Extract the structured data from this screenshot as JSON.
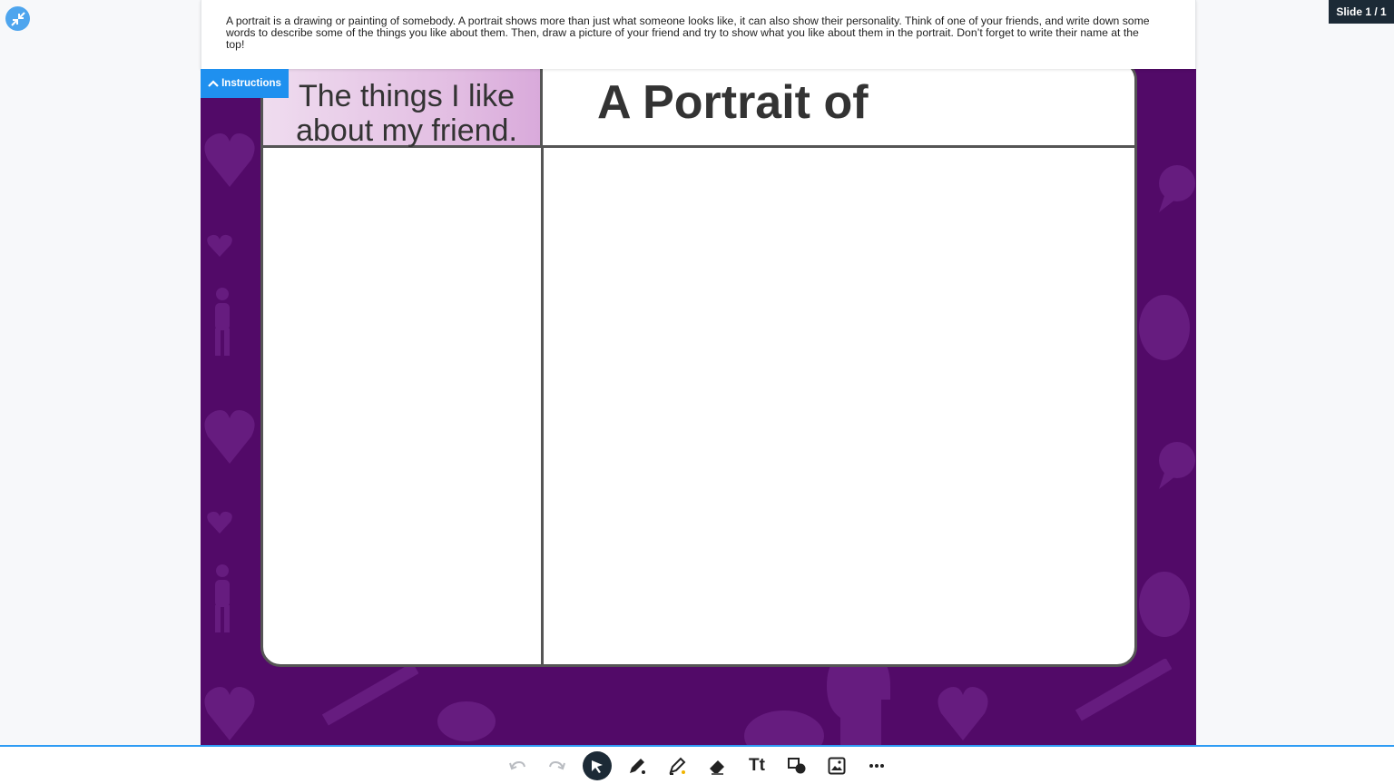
{
  "instructions": {
    "text": "A portrait is a drawing or painting of somebody. A portrait shows more than just what someone looks like, it can also show their personality. Think of one of your friends, and write down some words to describe some of the things you like about them. Then, draw a picture of your friend and try to show what you like about them in the portrait. Don’t forget to write their name at the top!",
    "toggle_label": "Instructions"
  },
  "slide_counter": "Slide 1 / 1",
  "worksheet": {
    "left_heading": "The things I like about my friend.",
    "right_heading": "A Portrait of"
  },
  "toolbar": {
    "tools": [
      "undo-icon",
      "redo-icon",
      "select-icon",
      "pen-icon",
      "highlighter-icon",
      "eraser-icon",
      "text-icon",
      "shapes-icon",
      "image-icon",
      "more-icon"
    ],
    "text_tool_label": "Tt"
  },
  "colors": {
    "background": "#520a68",
    "accent": "#1f90ef",
    "toolbar_active": "#1c2a36"
  }
}
